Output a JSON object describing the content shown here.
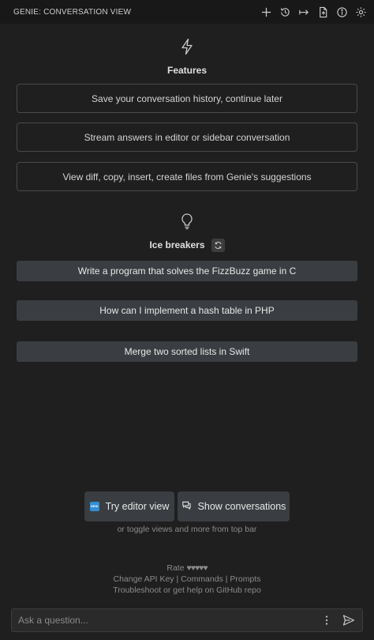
{
  "header": {
    "title": "GENIE: CONVERSATION VIEW",
    "actions": [
      {
        "icon": "plus-icon",
        "label": "New conversation"
      },
      {
        "icon": "history-icon",
        "label": "History"
      },
      {
        "icon": "arrow-right-bar-icon",
        "label": "Move"
      },
      {
        "icon": "file-export-icon",
        "label": "Export"
      },
      {
        "icon": "info-icon",
        "label": "Info"
      },
      {
        "icon": "gear-icon",
        "label": "Settings"
      }
    ]
  },
  "features": {
    "icon": "lightning-icon",
    "title": "Features",
    "items": [
      "Save your conversation history, continue later",
      "Stream answers in editor or sidebar conversation",
      "View diff, copy, insert, create files from Genie's suggestions"
    ]
  },
  "ice_breakers": {
    "icon": "lightbulb-icon",
    "title": "Ice breakers",
    "items": [
      "Write a program that solves the FizzBuzz game in C",
      "How can I implement a hash table in PHP",
      "Merge two sorted lists in Swift"
    ]
  },
  "views": {
    "editor_button": "Try editor view",
    "editor_badge": "NEW",
    "conversations_button": "Show conversations",
    "hint": "or toggle views and more from top bar"
  },
  "footer": {
    "rate_label": "Rate",
    "hearts": "♥♥♥♥♥",
    "change_api_key": "Change API Key",
    "separator": "|",
    "commands": "Commands",
    "prompts": "Prompts",
    "troubleshoot": "Troubleshoot or get help on GitHub repo"
  },
  "input": {
    "placeholder": "Ask a question..."
  },
  "colors": {
    "background": "#1f1f1f",
    "button_bg": "#3a3d41",
    "badge": "#2f8fd6"
  }
}
